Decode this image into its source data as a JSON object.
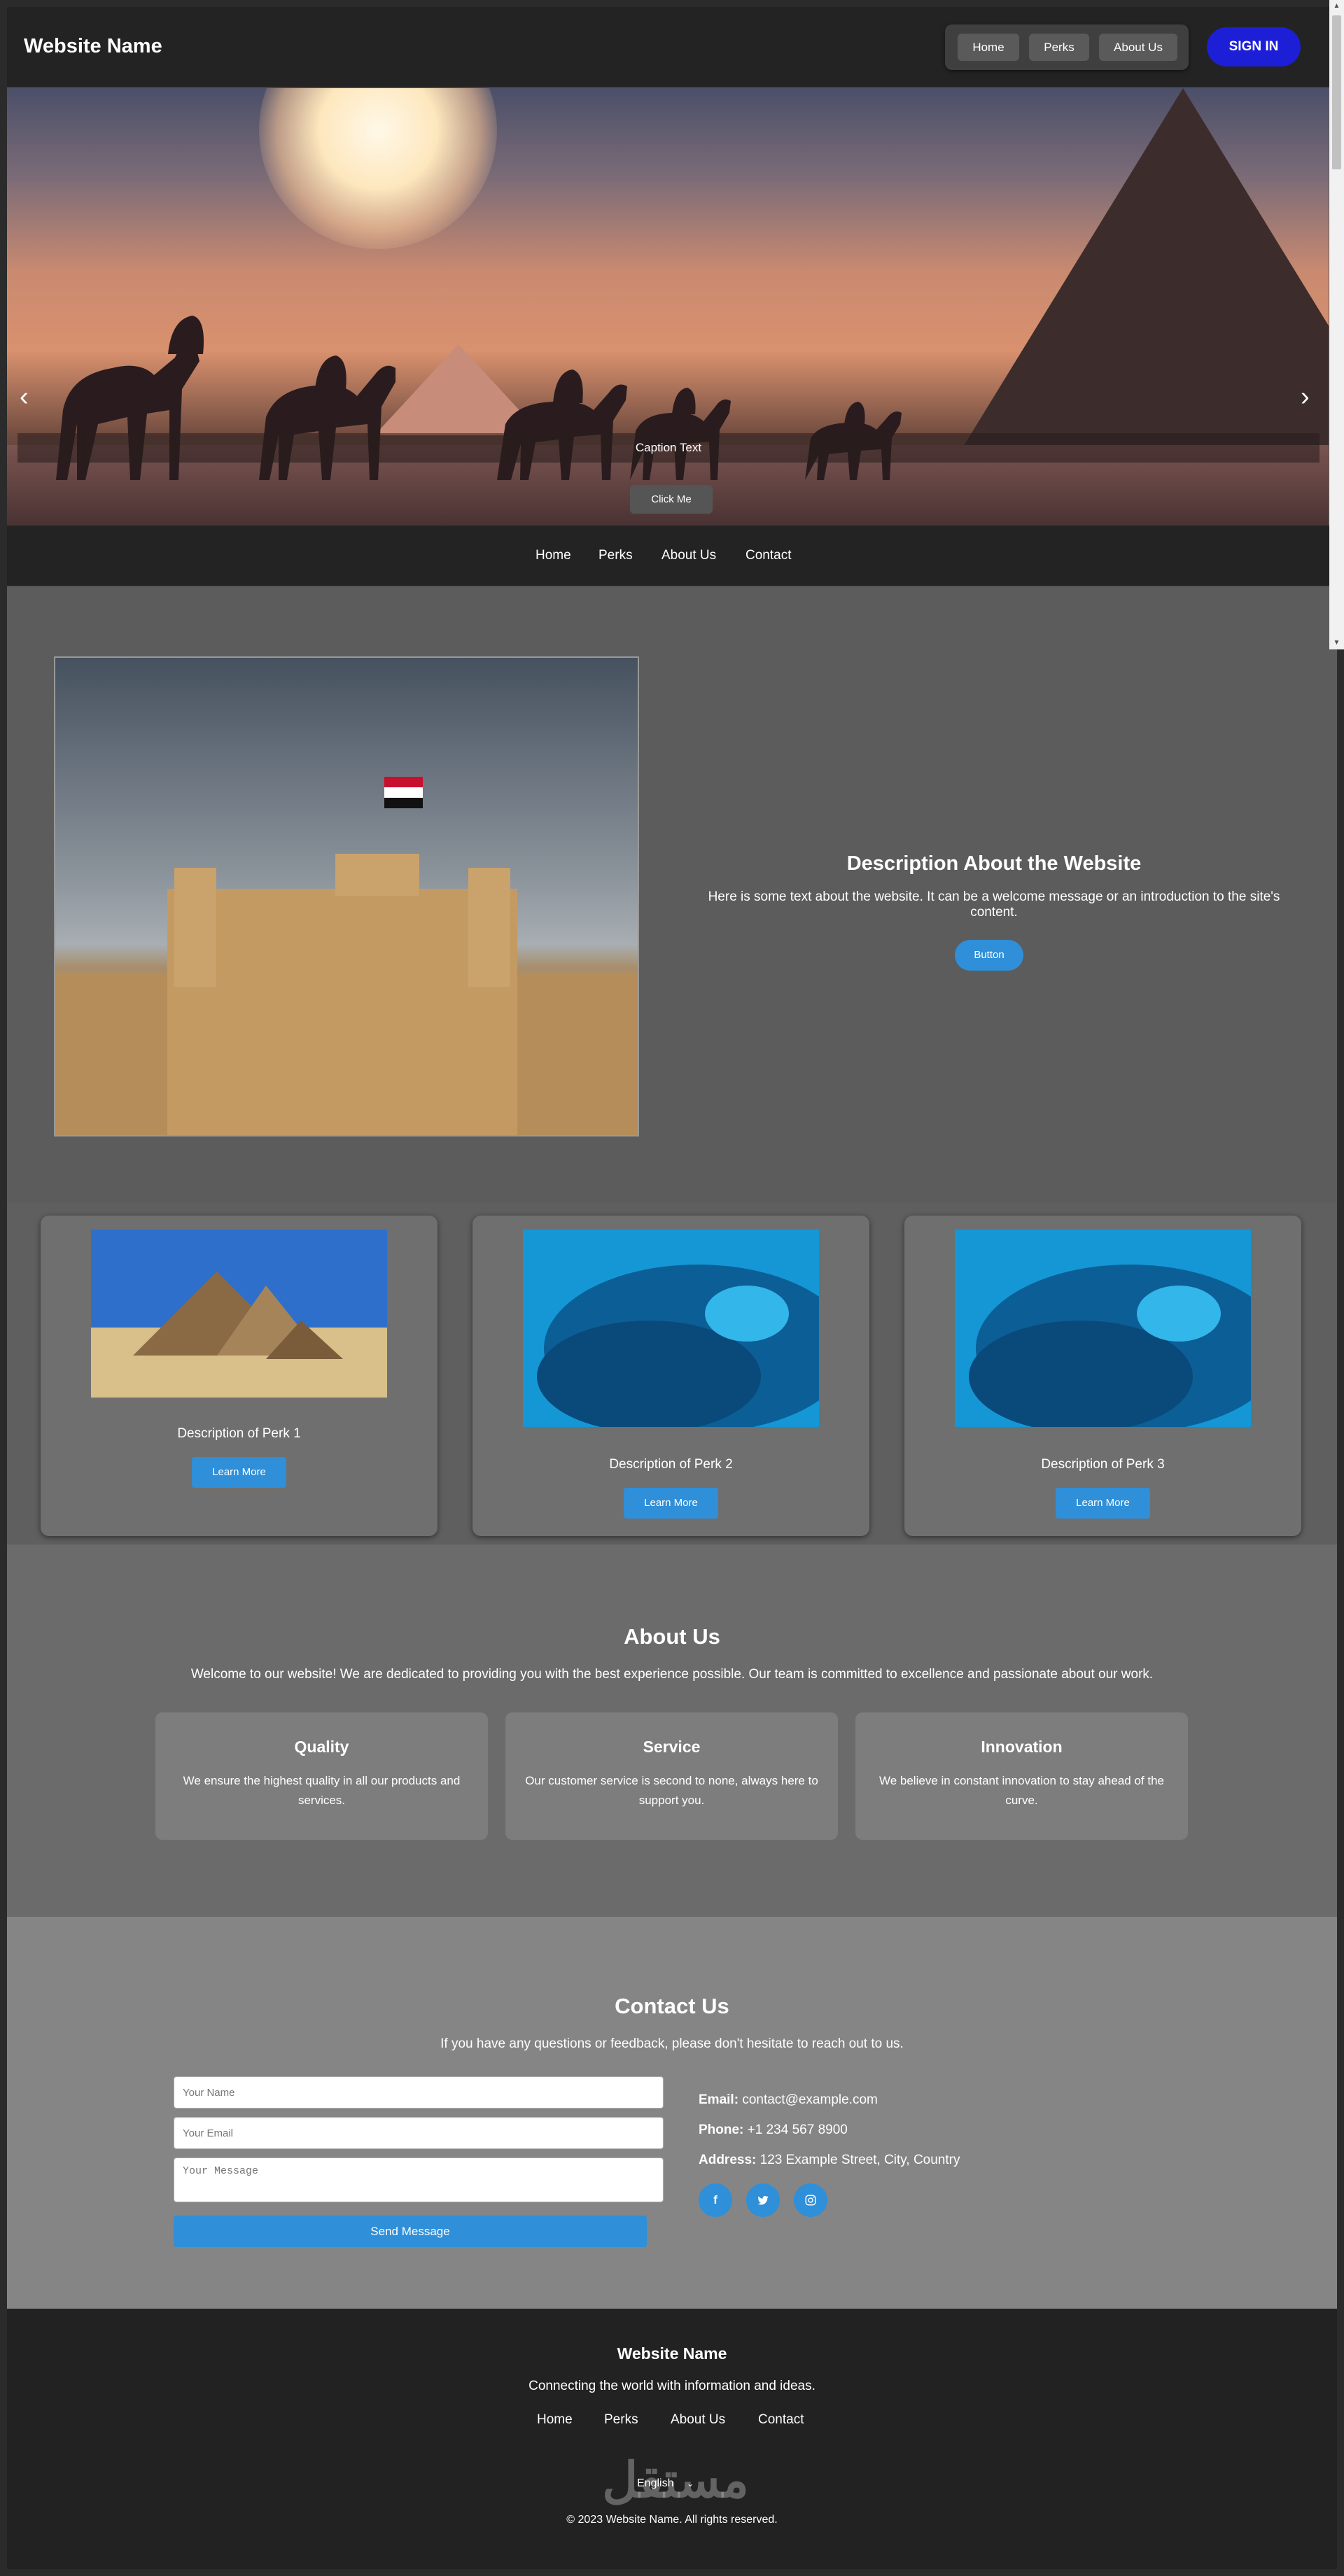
{
  "header": {
    "site_name": "Website Name",
    "nav": [
      "Home",
      "Perks",
      "About Us"
    ],
    "signin_label": "SIGN IN"
  },
  "hero": {
    "caption": "Caption Text",
    "button_label": "Click Me",
    "prev_arrow": "‹",
    "next_arrow": "›"
  },
  "sub_nav": [
    "Home",
    "Perks",
    "About Us",
    "Contact"
  ],
  "description": {
    "title": "Description About the Website",
    "text": "Here is some text about the website. It can be a welcome message or an introduction to the site's content.",
    "button_label": "Button"
  },
  "perks": [
    {
      "description": "Description of Perk 1",
      "button_label": "Learn More"
    },
    {
      "description": "Description of Perk 2",
      "button_label": "Learn More"
    },
    {
      "description": "Description of Perk 3",
      "button_label": "Learn More"
    }
  ],
  "about": {
    "title": "About Us",
    "text": "Welcome to our website! We are dedicated to providing you with the best experience possible. Our team is committed to excellence and passionate about our work.",
    "cards": [
      {
        "title": "Quality",
        "text": "We ensure the highest quality in all our products and services."
      },
      {
        "title": "Service",
        "text": "Our customer service is second to none, always here to support you."
      },
      {
        "title": "Innovation",
        "text": "We believe in constant innovation to stay ahead of the curve."
      }
    ]
  },
  "contact": {
    "title": "Contact Us",
    "subtitle": "If you have any questions or feedback, please don't hesitate to reach out to us.",
    "name_placeholder": "Your Name",
    "email_placeholder": "Your Email",
    "message_placeholder": "Your Message",
    "send_label": "Send Message",
    "email_label": "Email:",
    "email_value": "contact@example.com",
    "phone_label": "Phone:",
    "phone_value": "+1 234 567 8900",
    "address_label": "Address:",
    "address_value": "123 Example Street, City, Country",
    "social_icons": [
      "facebook-icon",
      "twitter-icon",
      "instagram-icon"
    ]
  },
  "footer": {
    "site_name": "Website Name",
    "tagline": "Connecting the world with information and ideas.",
    "links": [
      "Home",
      "Perks",
      "About Us",
      "Contact"
    ],
    "language": "English",
    "copyright": "© 2023 Website Name. All rights reserved.",
    "watermark": "مستقل"
  },
  "colors": {
    "accent": "#2f8fd8",
    "signin": "#1c1fd6",
    "header_bg": "#232323"
  }
}
